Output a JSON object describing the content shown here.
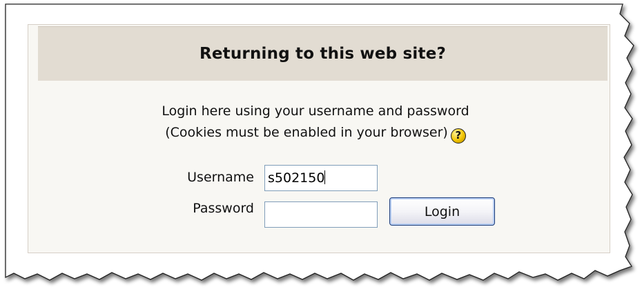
{
  "header": {
    "title": "Returning to this web site?"
  },
  "info": {
    "line1": "Login here using your username and password",
    "line2": "(Cookies must be enabled in your browser)",
    "help_icon": "question-help-icon"
  },
  "form": {
    "username_label": "Username",
    "username_value": "s502150",
    "password_label": "Password",
    "password_value": "",
    "login_label": "Login"
  },
  "colors": {
    "header_bg": "#e2dcd2",
    "card_bg": "#f8f7f3",
    "button_border": "#1e3d7a",
    "help_icon": "#f2c400"
  }
}
